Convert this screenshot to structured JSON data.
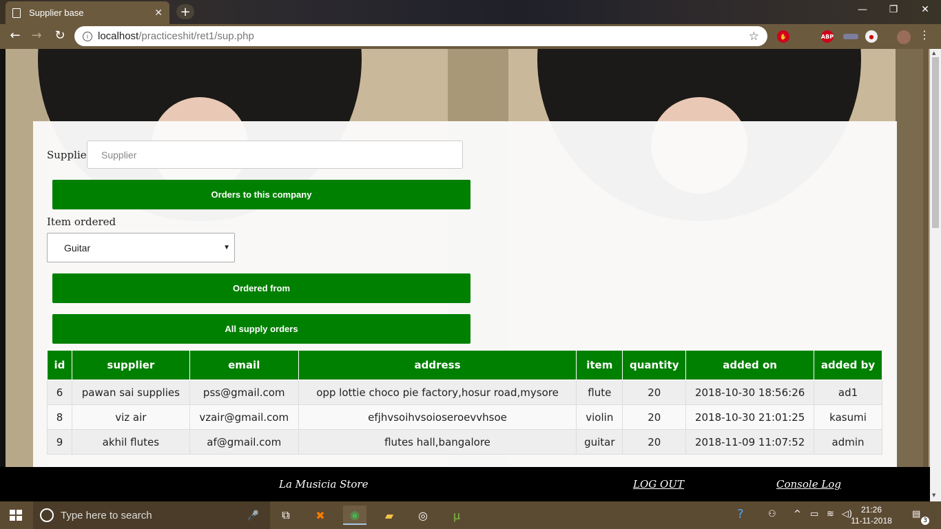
{
  "browser": {
    "tab_title": "Supplier base",
    "tab_close": "✕",
    "new_tab": "+",
    "url_host": "localhost",
    "url_path": "/practiceshit/ret1/sup.php",
    "window_controls": [
      "—",
      "❐",
      "✕"
    ]
  },
  "form": {
    "supplier_label": "Supplier",
    "supplier_placeholder": "Supplier",
    "supplier_value": "",
    "orders_button": "Orders to this company",
    "item_label": "Item ordered",
    "item_selected": "Guitar",
    "ordered_from_button": "Ordered from",
    "all_orders_button": "All supply orders"
  },
  "table": {
    "headers": [
      "id",
      "supplier",
      "email",
      "address",
      "item",
      "quantity",
      "added on",
      "added by"
    ],
    "rows": [
      [
        "6",
        "pawan sai supplies",
        "pss@gmail.com",
        "opp lottie choco pie factory,hosur road,mysore",
        "flute",
        "20",
        "2018-10-30 18:56:26",
        "ad1"
      ],
      [
        "8",
        "viz air",
        "vzair@gmail.com",
        "efjhvsoihvsoioseroevvhsoe",
        "violin",
        "20",
        "2018-10-30 21:01:25",
        "kasumi"
      ],
      [
        "9",
        "akhil flutes",
        "af@gmail.com",
        "flutes hall,bangalore",
        "guitar",
        "20",
        "2018-11-09 11:07:52",
        "admin"
      ]
    ]
  },
  "footer": {
    "store_name": "La Musicia Store",
    "logout": "LOG OUT",
    "console_log": "Console Log"
  },
  "taskbar": {
    "search_placeholder": "Type here to search",
    "time": "21:26",
    "date": "11-11-2018",
    "notification_count": "3"
  },
  "colors": {
    "accent_green": "#008000",
    "chrome_brown": "#6b5a3e",
    "taskbar_brown": "#5c4b33"
  }
}
